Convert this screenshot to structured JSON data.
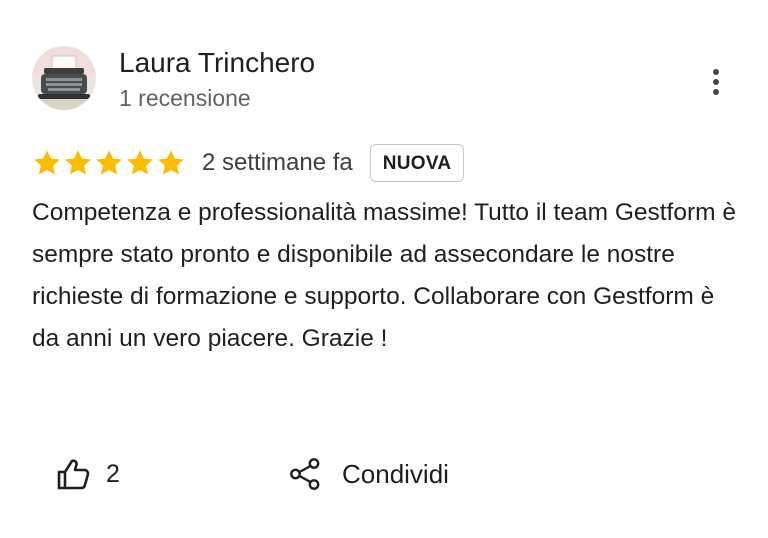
{
  "author": {
    "name": "Laura Trinchero",
    "subtitle": "1 recensione",
    "avatar_icon": "typewriter-avatar"
  },
  "menu": {
    "icon": "more-vert-icon"
  },
  "review": {
    "rating": 5,
    "rating_max": 5,
    "star_color": "#fbbc04",
    "date": "2 settimane fa",
    "badge": "NUOVA",
    "text": "Competenza e professionalità massime! Tutto il team Gestform è sempre stato pronto e disponibile ad assecondare le nostre richieste di formazione e supporto. Collaborare con Gestform è da anni un vero piacere. Grazie !"
  },
  "actions": {
    "like_icon": "thumb-up-icon",
    "like_count": "2",
    "share_icon": "share-icon",
    "share_label": "Condividi"
  }
}
